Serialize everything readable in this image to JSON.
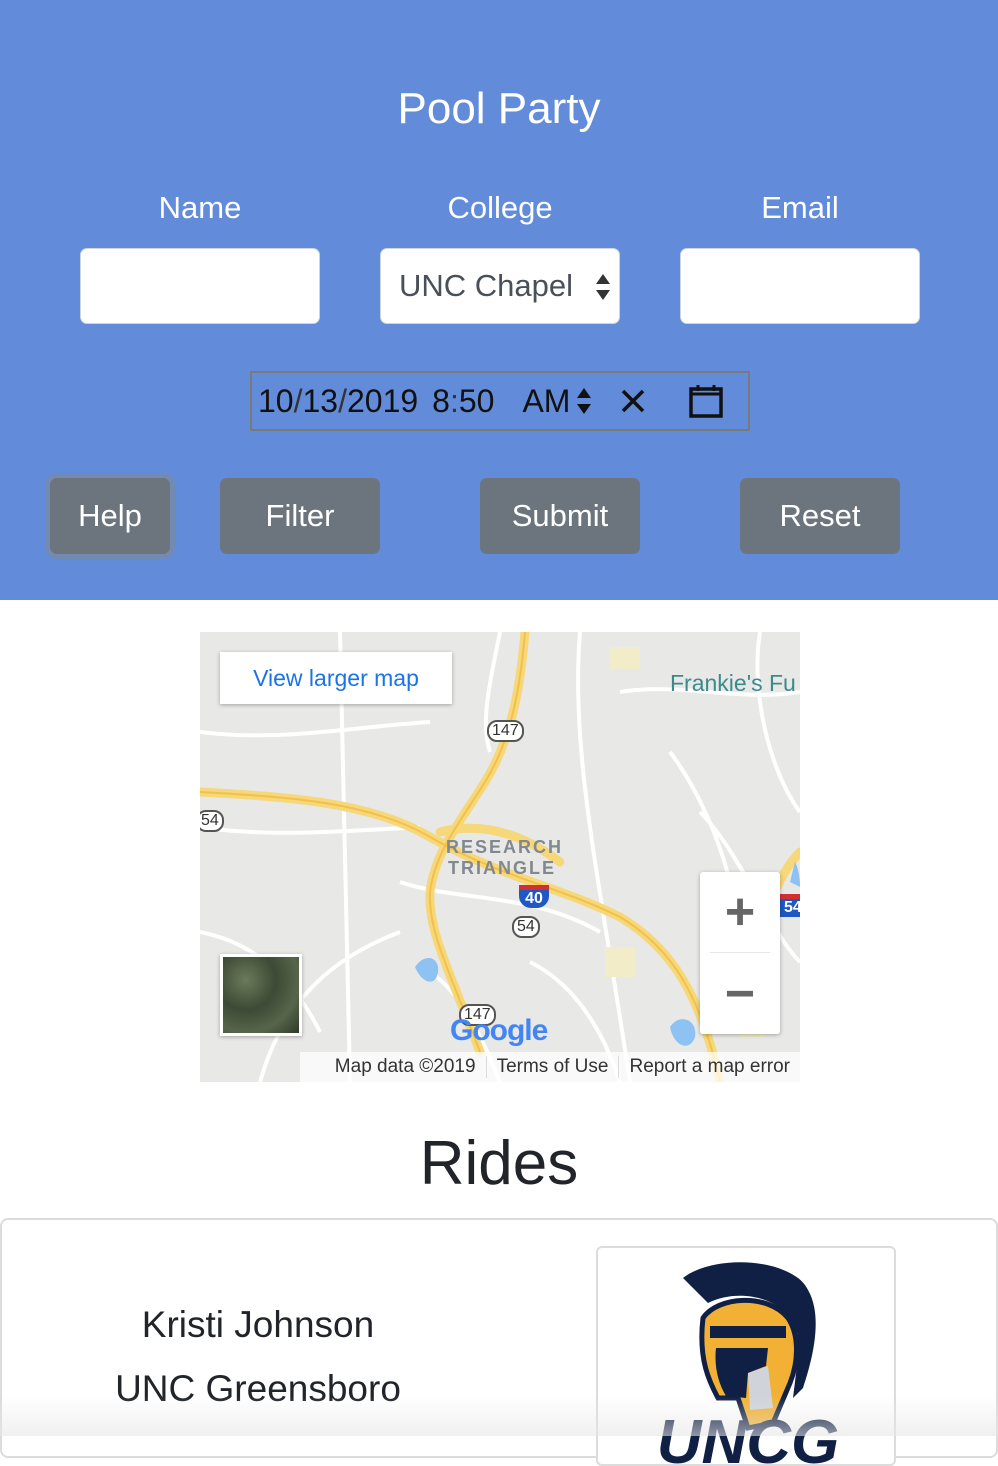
{
  "header": {
    "title": "Pool Party",
    "bg_color": "#628bda"
  },
  "form": {
    "name_label": "Name",
    "name_value": "",
    "college_label": "College",
    "college_selected": "UNC Chapel",
    "email_label": "Email",
    "email_value": "",
    "datetime": {
      "month": "10",
      "day": "13",
      "year": "2019",
      "hour": "8",
      "minute": "50",
      "ampm": "AM"
    }
  },
  "buttons": {
    "help": "Help",
    "filter": "Filter",
    "submit": "Submit",
    "reset": "Reset",
    "color": "#6c757d"
  },
  "map": {
    "view_larger": "View larger map",
    "place_label": "Frankie's Fu",
    "area_label_1": "RESEARCH",
    "area_label_2": "TRIANGLE",
    "shields": [
      "147",
      "54",
      "40",
      "54",
      "147",
      "54"
    ],
    "zoom_in": "+",
    "zoom_out": "−",
    "logo": "Google",
    "map_data": "Map data ©2019",
    "terms": "Terms of Use",
    "report": "Report a map error"
  },
  "rides": {
    "title": "Rides",
    "items": [
      {
        "name": "Kristi Johnson",
        "college": "UNC Greensboro",
        "logo_text": "UNCG"
      }
    ]
  }
}
